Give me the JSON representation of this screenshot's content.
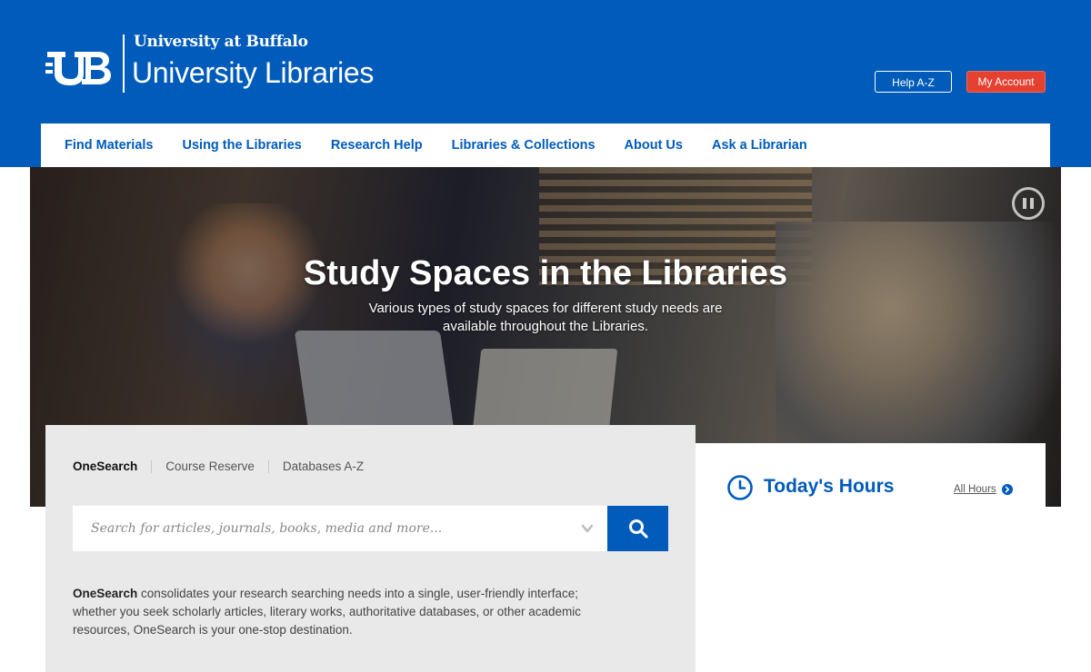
{
  "header": {
    "university_name": "University at Buffalo",
    "site_name": "University Libraries",
    "help_button": "Help A-Z",
    "account_button": "My Account"
  },
  "nav": {
    "items": [
      {
        "label": "Find Materials"
      },
      {
        "label": "Using the Libraries"
      },
      {
        "label": "Research Help"
      },
      {
        "label": "Libraries & Collections"
      },
      {
        "label": "About Us"
      },
      {
        "label": "Ask a Librarian"
      }
    ]
  },
  "hero": {
    "title": "Study Spaces in the Libraries",
    "subtitle": "Various types of study spaces for different study needs are available throughout the Libraries."
  },
  "search": {
    "tabs": [
      {
        "label": "OneSearch"
      },
      {
        "label": "Course Reserve"
      },
      {
        "label": "Databases A-Z"
      }
    ],
    "placeholder": "Search for articles, journals, books, media and more...",
    "description_lead": "OneSearch",
    "description_rest": " consolidates your research searching needs into a single, user-friendly interface; whether you seek scholarly articles, literary works, authoritative databases, or other academic resources, OneSearch is your one-stop destination."
  },
  "hours": {
    "title": "Today's Hours",
    "all_hours_link": "All Hours"
  },
  "colors": {
    "brand_blue": "#005bbb",
    "account_red": "#e44131",
    "panel_gray": "#e8e9e8"
  },
  "icons": [
    "ub-logo",
    "pause-icon",
    "search-icon",
    "chevron-down-icon",
    "clock-icon",
    "arrow-right-circle-icon"
  ]
}
